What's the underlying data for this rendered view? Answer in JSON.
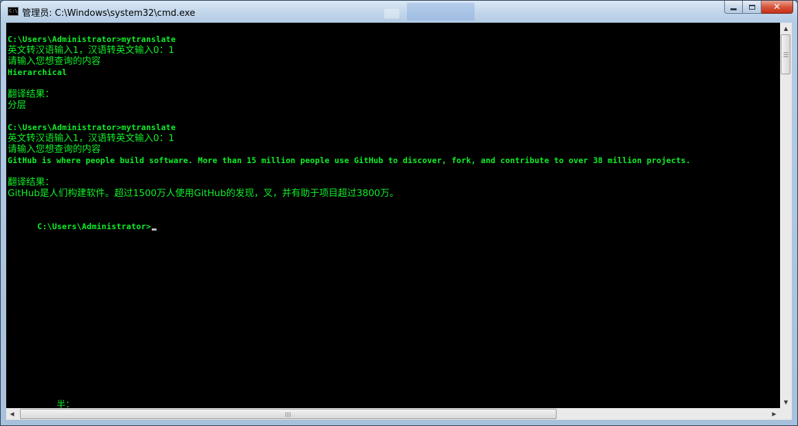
{
  "window": {
    "title": "管理员: C:\\Windows\\system32\\cmd.exe",
    "icon": "cmd-icon",
    "icon_text": "C:\\",
    "buttons": {
      "minimize": "minimize-icon",
      "maximize": "maximize-icon",
      "close": "close-icon",
      "close_glyph": "✕"
    }
  },
  "console": {
    "colors": {
      "text": "#0ff028",
      "background": "#000000"
    },
    "lines": [
      "C:\\Users\\Administrator>mytranslate",
      "英文转汉语输入1，汉语转英文输入0：1",
      "请输入您想查询的内容",
      "Hierarchical",
      "",
      "翻译结果：",
      "分层",
      "",
      "C:\\Users\\Administrator>mytranslate",
      "英文转汉语输入1，汉语转英文输入0：1",
      "请输入您想查询的内容",
      "GitHub is where people build software. More than 15 million people use GitHub to discover, fork, and contribute to over 38 million projects.",
      "",
      "翻译结果：",
      "GitHub是人们构建软件。超过1500万人使用GitHub的发现，叉，并有助于项目超过3800万。",
      "",
      "C:\\Users\\Administrator>"
    ],
    "ime_status": "半："
  },
  "scrollbars": {
    "up_arrow": "▲",
    "down_arrow": "▼",
    "left_arrow": "◀",
    "right_arrow": "▶"
  }
}
